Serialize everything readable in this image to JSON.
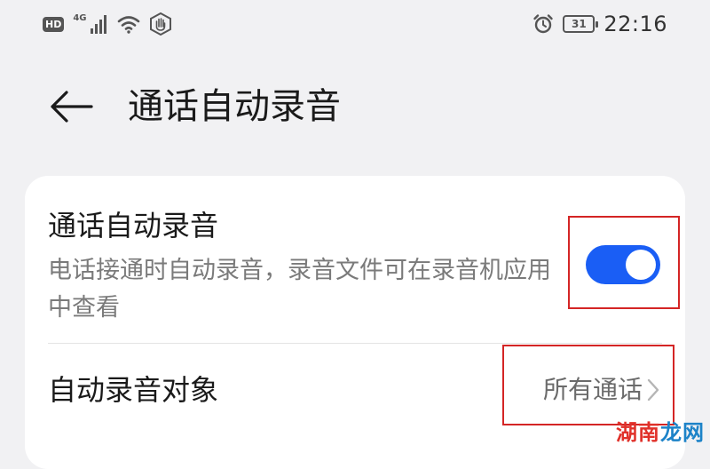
{
  "status_bar": {
    "hd_badge": "HD",
    "network_type": "4G",
    "battery_level": "31",
    "time": "22:16"
  },
  "header": {
    "title": "通话自动录音"
  },
  "settings": {
    "auto_record": {
      "title": "通话自动录音",
      "description": "电话接通时自动录音，录音文件可在录音机应用中查看",
      "enabled": true
    },
    "record_target": {
      "label": "自动录音对象",
      "value": "所有通话"
    }
  },
  "watermark": {
    "part1": "湖南",
    "part2": "龙网"
  },
  "icons": [
    "back-arrow-icon",
    "signal-icon",
    "wifi-icon",
    "hand-icon",
    "alarm-icon",
    "battery-icon",
    "chevron-right-icon"
  ],
  "colors": {
    "accent": "#1a5ef5",
    "highlight": "#d42525",
    "background": "#f1f1f3",
    "card": "#ffffff"
  }
}
